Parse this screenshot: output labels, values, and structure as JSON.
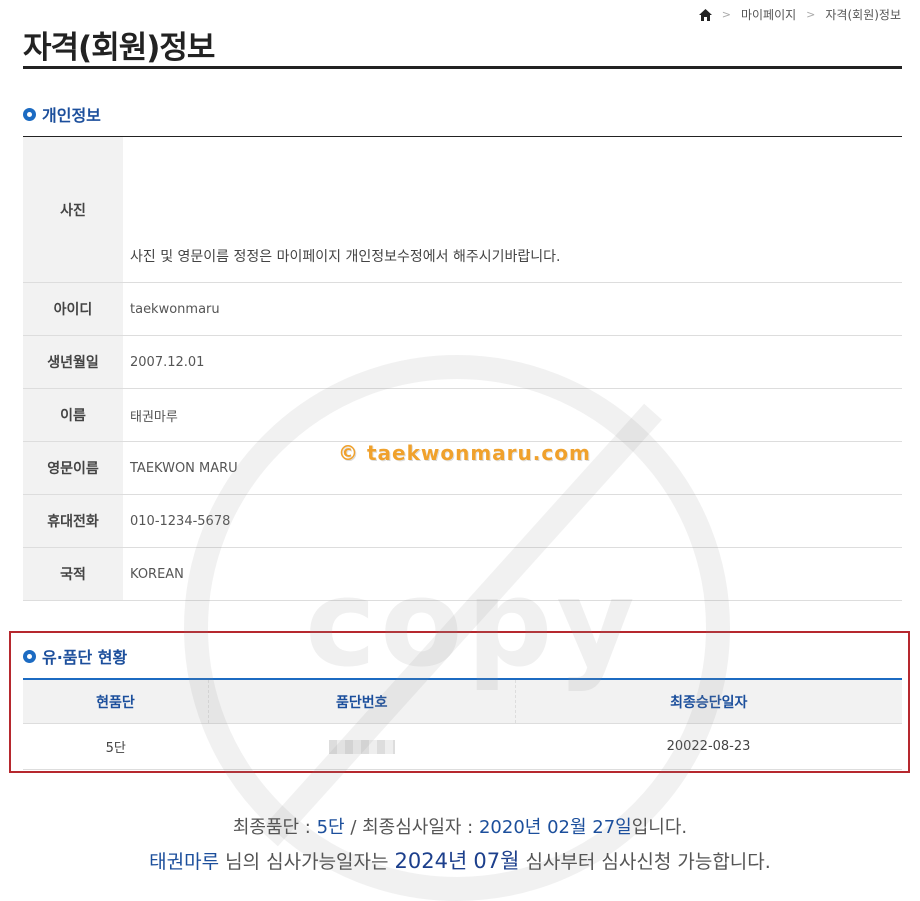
{
  "breadcrumb": {
    "home_icon": "home-icon",
    "sep": ">",
    "items": [
      "마이페이지",
      "자격(회원)정보"
    ]
  },
  "page_title": "자격(회원)정보",
  "personal": {
    "heading": "개인정보",
    "photo_label": "사진",
    "photo_note": "사진 및 영문이름 정정은 마이페이지 개인정보수정에서 해주시기바랍니다.",
    "rows": [
      {
        "label": "아이디",
        "value": "taekwonmaru"
      },
      {
        "label": "생년월일",
        "value": "2007.12.01"
      },
      {
        "label": "이름",
        "value": "태권마루"
      },
      {
        "label": "영문이름",
        "value": "TAEKWON MARU"
      },
      {
        "label": "휴대전화",
        "value": "010-1234-5678"
      },
      {
        "label": "국적",
        "value": "KOREAN"
      }
    ]
  },
  "watermark": {
    "text": "© taekwonmaru.com",
    "copy": "copy"
  },
  "grade": {
    "heading": "유·품단 현황",
    "columns": [
      "현품단",
      "품단번호",
      "최종승단일자"
    ],
    "row": {
      "grade": "5단",
      "number": "",
      "date": "20022-08-23"
    }
  },
  "summary": {
    "l1_a": "최종품단 : ",
    "l1_grade": "5단",
    "l1_b": " / 최종심사일자 : ",
    "l1_year": "2020년",
    "l1_month": "02월",
    "l1_day": "27일",
    "l1_c": "입니다.",
    "l2_name": "태권마루",
    "l2_a": " 님의 심사가능일자는 ",
    "l2_year": "2024년",
    "l2_month": "07월",
    "l2_b": " 심사부터 심사신청 가능합니다."
  }
}
